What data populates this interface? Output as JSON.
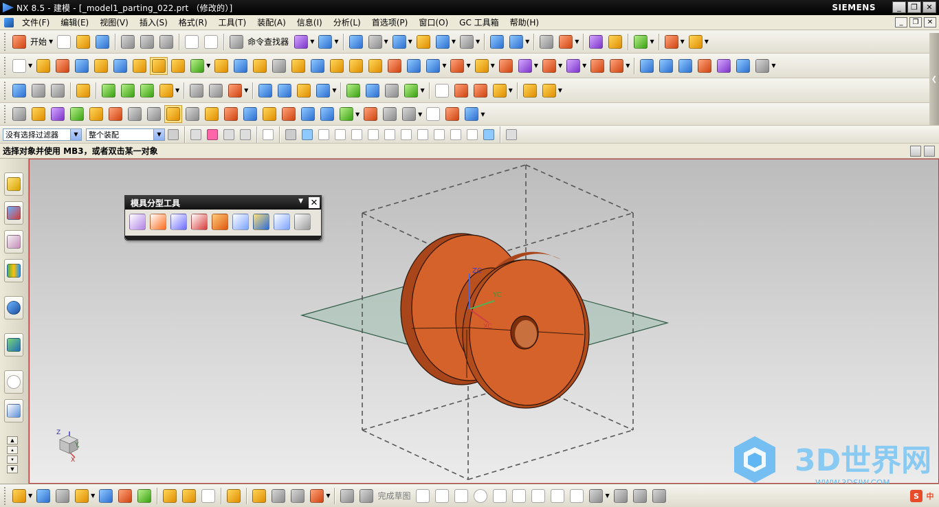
{
  "window": {
    "title": "NX 8.5 - 建模 - [_model1_parting_022.prt （修改的）]",
    "brand": "SIEMENS",
    "controls": [
      "_",
      "❐",
      "✕"
    ]
  },
  "menubar": {
    "items": [
      "文件(F)",
      "编辑(E)",
      "视图(V)",
      "插入(S)",
      "格式(R)",
      "工具(T)",
      "装配(A)",
      "信息(I)",
      "分析(L)",
      "首选项(P)",
      "窗口(O)",
      "GC 工具箱",
      "帮助(H)"
    ],
    "mdi_controls": [
      "_",
      "❐",
      "✕"
    ]
  },
  "toolbar": {
    "start_label": "开始",
    "command_finder_label": "命令查找器"
  },
  "selection_bar": {
    "filter_value": "没有选择过滤器",
    "scope_value": "整个装配"
  },
  "cue_line": {
    "text": "选择对象并使用 MB3，或者双击某一对象"
  },
  "floating_toolbar": {
    "title": "模具分型工具",
    "close": "✕"
  },
  "bottom_toolbar": {
    "finish_sketch_label": "完成草图"
  },
  "triad": {
    "z": "Z",
    "y": "Y",
    "x": "X"
  },
  "wcs": {
    "zc": "ZC",
    "yc": "YC",
    "xc": "XC"
  },
  "watermark": {
    "text": "3D世界网",
    "url": "WWW.3DSJW.COM"
  },
  "colors": {
    "part": "#d4622a",
    "parting_plane": "#9fbfae",
    "viewport_top": "#bcbcbc",
    "viewport_bottom": "#ececec"
  }
}
